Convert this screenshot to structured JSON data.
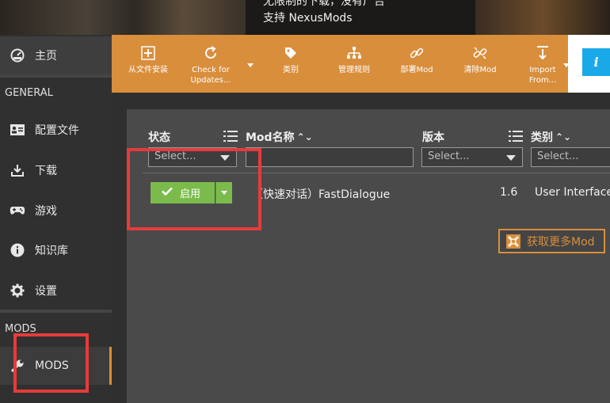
{
  "banner": {
    "line1": "无限制的下载，没有广告",
    "line2": "支持 NexusMods"
  },
  "sidebar": {
    "home": "主页",
    "general_header": "GENERAL",
    "items": [
      {
        "label": "配置文件",
        "icon": "profile-icon"
      },
      {
        "label": "下载",
        "icon": "download-icon"
      },
      {
        "label": "游戏",
        "icon": "gamepad-icon"
      },
      {
        "label": "知识库",
        "icon": "info-icon"
      },
      {
        "label": "设置",
        "icon": "gear-icon"
      }
    ],
    "mods_header": "MODS",
    "mods_item": "MODS"
  },
  "toolbar": {
    "install": "从文件安装",
    "check_updates_1": "Check for",
    "check_updates_2": "Updates...",
    "category": "类别",
    "manage_rules": "管理规则",
    "deploy": "部署Mod",
    "purge": "清除Mod",
    "import_1": "Import",
    "import_2": "From..."
  },
  "table": {
    "columns": {
      "status": "状态",
      "mod_name": "Mod名称",
      "version": "版本",
      "category": "类别"
    },
    "filters": {
      "status_placeholder": "Select...",
      "name_value": "",
      "version_placeholder": "Select...",
      "category_placeholder": "Select..."
    },
    "rows": [
      {
        "status": "启用",
        "name": "（快速对话）FastDialogue",
        "version": "1.6",
        "category": "User Interface"
      }
    ]
  },
  "get_more": "获取更多Mod",
  "colors": {
    "accent": "#d98e3c",
    "enabled": "#7bbb4b",
    "highlight": "#e63b3b",
    "info": "#1aa9e8"
  }
}
